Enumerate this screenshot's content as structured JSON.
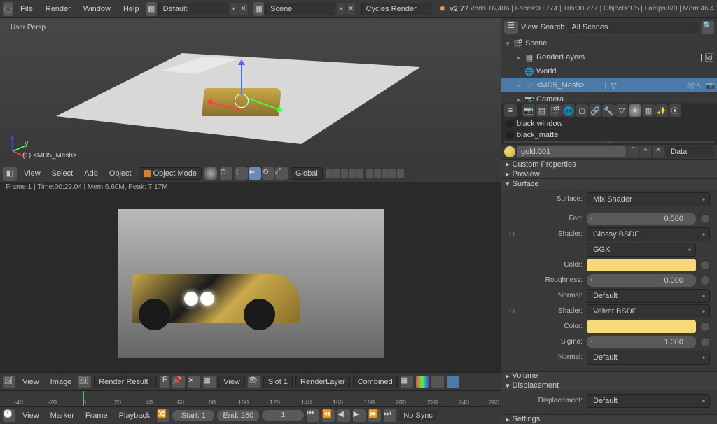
{
  "topbar": {
    "menus": [
      "File",
      "Render",
      "Window",
      "Help"
    ],
    "layout": "Default",
    "scene": "Scene",
    "engine": "Cycles Render",
    "version": "v2.77",
    "stats": "Verts:16,486 | Faces:30,774 | Tris:30,777 | Objects:1/5 | Lamps:0/0 | Mem:46.4"
  },
  "viewport": {
    "persp": "User Persp",
    "object_label": "(1) <MD5_Mesh>",
    "header_menus": [
      "View",
      "Select",
      "Add",
      "Object"
    ],
    "mode": "Object Mode",
    "orientation": "Global"
  },
  "render_status": "Frame:1 | Time:00:29.04 | Mem:6.60M, Peak: 7.17M",
  "image_header": {
    "menus": [
      "View",
      "Image"
    ],
    "result": "Render Result",
    "f": "F",
    "view_dd": "View",
    "slot": "Slot 1",
    "layer": "RenderLayer",
    "pass": "Combined"
  },
  "timeline": {
    "ticks": [
      "-40",
      "-20",
      "0",
      "20",
      "40",
      "60",
      "80",
      "100",
      "120",
      "140",
      "160",
      "180",
      "200",
      "220",
      "240",
      "260"
    ],
    "header_menus": [
      "View",
      "Marker",
      "Frame",
      "Playback"
    ],
    "start_label": "Start:",
    "start": "1",
    "end_label": "End:",
    "end": "250",
    "current": "1",
    "sync": "No Sync"
  },
  "outliner": {
    "header_menus": [
      "View",
      "Search"
    ],
    "filter": "All Scenes",
    "items": [
      {
        "indent": 0,
        "tri": "▾",
        "icon": "scene",
        "label": "Scene"
      },
      {
        "indent": 1,
        "tri": "▸",
        "icon": "renderlayers",
        "label": "RenderLayers",
        "pipe": true
      },
      {
        "indent": 1,
        "tri": "",
        "icon": "world",
        "label": "World"
      },
      {
        "indent": 1,
        "tri": "▸",
        "icon": "mesh",
        "label": "<MD5_Mesh>",
        "selected": true,
        "extra": true
      },
      {
        "indent": 1,
        "tri": "▸",
        "icon": "camera",
        "label": "Camera"
      }
    ]
  },
  "materials": {
    "list": [
      "black window",
      "black_matte"
    ],
    "active_name": "gold.001",
    "f": "F",
    "node_type": "Data"
  },
  "panels": {
    "custom_props": "Custom Properties",
    "preview": "Preview",
    "surface": "Surface",
    "volume": "Volume",
    "displacement": "Displacement",
    "settings": "Settings"
  },
  "surface": {
    "surface_label": "Surface:",
    "surface_value": "Mix Shader",
    "fac_label": "Fac:",
    "fac_value": "0.500",
    "shader1_label": "Shader:",
    "shader1_value": "Glossy BSDF",
    "shader1_dist": "GGX",
    "shader1_color_label": "Color:",
    "shader1_roughness_label": "Roughness:",
    "shader1_roughness_value": "0.000",
    "shader1_normal_label": "Normal:",
    "shader1_normal_value": "Default",
    "shader2_label": "Shader:",
    "shader2_value": "Velvet BSDF",
    "shader2_color_label": "Color:",
    "shader2_sigma_label": "Sigma:",
    "shader2_sigma_value": "1.000",
    "shader2_normal_label": "Normal:",
    "shader2_normal_value": "Default"
  },
  "displacement": {
    "label": "Displacement:",
    "value": "Default"
  },
  "colors": {
    "gold": "#f8d97a"
  }
}
